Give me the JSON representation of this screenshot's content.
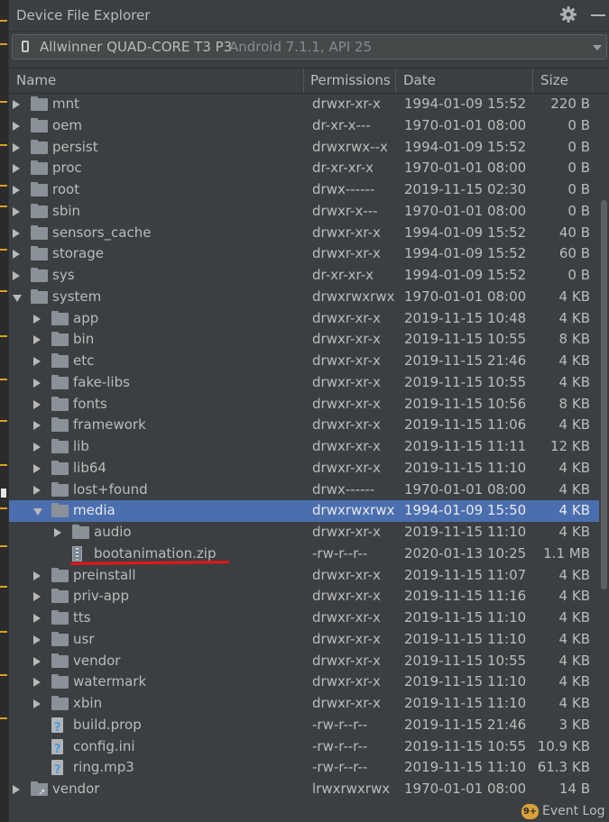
{
  "window": {
    "title": "Device File Explorer",
    "icons": [
      "gear-icon",
      "minimize-icon"
    ]
  },
  "device": {
    "name": "Allwinner QUAD-CORE T3 P3",
    "version": "Android 7.1.1, API 25"
  },
  "columns": {
    "name": "Name",
    "permissions": "Permissions",
    "date": "Date",
    "size": "Size"
  },
  "rows": [
    {
      "name": "mnt",
      "perm": "drwxr-xr-x",
      "date": "1994-01-09 15:52",
      "size": "220 B",
      "depth": 0,
      "type": "folder",
      "state": "closed"
    },
    {
      "name": "oem",
      "perm": "dr-xr-x---",
      "date": "1970-01-01 08:00",
      "size": "0 B",
      "depth": 0,
      "type": "folder",
      "state": "closed"
    },
    {
      "name": "persist",
      "perm": "drwxrwx--x",
      "date": "1994-01-09 15:52",
      "size": "0 B",
      "depth": 0,
      "type": "folder",
      "state": "closed"
    },
    {
      "name": "proc",
      "perm": "dr-xr-xr-x",
      "date": "1970-01-01 08:00",
      "size": "0 B",
      "depth": 0,
      "type": "folder",
      "state": "closed"
    },
    {
      "name": "root",
      "perm": "drwx------",
      "date": "2019-11-15 02:30",
      "size": "0 B",
      "depth": 0,
      "type": "folder",
      "state": "closed"
    },
    {
      "name": "sbin",
      "perm": "drwxr-x---",
      "date": "1970-01-01 08:00",
      "size": "0 B",
      "depth": 0,
      "type": "folder",
      "state": "closed"
    },
    {
      "name": "sensors_cache",
      "perm": "drwxr-xr-x",
      "date": "1994-01-09 15:52",
      "size": "40 B",
      "depth": 0,
      "type": "folder",
      "state": "closed"
    },
    {
      "name": "storage",
      "perm": "drwxr-xr-x",
      "date": "1994-01-09 15:52",
      "size": "60 B",
      "depth": 0,
      "type": "folder",
      "state": "closed"
    },
    {
      "name": "sys",
      "perm": "dr-xr-xr-x",
      "date": "1994-01-09 15:52",
      "size": "0 B",
      "depth": 0,
      "type": "folder",
      "state": "closed"
    },
    {
      "name": "system",
      "perm": "drwxrwxrwx",
      "date": "1970-01-01 08:00",
      "size": "4 KB",
      "depth": 0,
      "type": "folder",
      "state": "open"
    },
    {
      "name": "app",
      "perm": "drwxr-xr-x",
      "date": "2019-11-15 10:48",
      "size": "4 KB",
      "depth": 1,
      "type": "folder",
      "state": "closed"
    },
    {
      "name": "bin",
      "perm": "drwxr-xr-x",
      "date": "2019-11-15 10:55",
      "size": "8 KB",
      "depth": 1,
      "type": "folder",
      "state": "closed"
    },
    {
      "name": "etc",
      "perm": "drwxr-xr-x",
      "date": "2019-11-15 21:46",
      "size": "4 KB",
      "depth": 1,
      "type": "folder",
      "state": "closed"
    },
    {
      "name": "fake-libs",
      "perm": "drwxr-xr-x",
      "date": "2019-11-15 10:55",
      "size": "4 KB",
      "depth": 1,
      "type": "folder",
      "state": "closed"
    },
    {
      "name": "fonts",
      "perm": "drwxr-xr-x",
      "date": "2019-11-15 10:56",
      "size": "8 KB",
      "depth": 1,
      "type": "folder",
      "state": "closed"
    },
    {
      "name": "framework",
      "perm": "drwxr-xr-x",
      "date": "2019-11-15 11:06",
      "size": "4 KB",
      "depth": 1,
      "type": "folder",
      "state": "closed"
    },
    {
      "name": "lib",
      "perm": "drwxr-xr-x",
      "date": "2019-11-15 11:11",
      "size": "12 KB",
      "depth": 1,
      "type": "folder",
      "state": "closed"
    },
    {
      "name": "lib64",
      "perm": "drwxr-xr-x",
      "date": "2019-11-15 11:10",
      "size": "4 KB",
      "depth": 1,
      "type": "folder",
      "state": "closed"
    },
    {
      "name": "lost+found",
      "perm": "drwx------",
      "date": "1970-01-01 08:00",
      "size": "4 KB",
      "depth": 1,
      "type": "folder",
      "state": "closed"
    },
    {
      "name": "media",
      "perm": "drwxrwxrwx",
      "date": "1994-01-09 15:50",
      "size": "4 KB",
      "depth": 1,
      "type": "folder",
      "state": "open",
      "selected": true
    },
    {
      "name": "audio",
      "perm": "drwxr-xr-x",
      "date": "2019-11-15 11:10",
      "size": "4 KB",
      "depth": 2,
      "type": "folder",
      "state": "closed"
    },
    {
      "name": "bootanimation.zip",
      "perm": "-rw-r--r--",
      "date": "2020-01-13 10:25",
      "size": "1.1 MB",
      "depth": 2,
      "type": "zip",
      "state": "none",
      "underlined": true
    },
    {
      "name": "preinstall",
      "perm": "drwxr-xr-x",
      "date": "2019-11-15 11:07",
      "size": "4 KB",
      "depth": 1,
      "type": "folder",
      "state": "closed"
    },
    {
      "name": "priv-app",
      "perm": "drwxr-xr-x",
      "date": "2019-11-15 11:16",
      "size": "4 KB",
      "depth": 1,
      "type": "folder",
      "state": "closed"
    },
    {
      "name": "tts",
      "perm": "drwxr-xr-x",
      "date": "2019-11-15 11:10",
      "size": "4 KB",
      "depth": 1,
      "type": "folder",
      "state": "closed"
    },
    {
      "name": "usr",
      "perm": "drwxr-xr-x",
      "date": "2019-11-15 11:10",
      "size": "4 KB",
      "depth": 1,
      "type": "folder",
      "state": "closed"
    },
    {
      "name": "vendor",
      "perm": "drwxr-xr-x",
      "date": "2019-11-15 10:55",
      "size": "4 KB",
      "depth": 1,
      "type": "folder",
      "state": "closed"
    },
    {
      "name": "watermark",
      "perm": "drwxr-xr-x",
      "date": "2019-11-15 11:10",
      "size": "4 KB",
      "depth": 1,
      "type": "folder",
      "state": "closed"
    },
    {
      "name": "xbin",
      "perm": "drwxr-xr-x",
      "date": "2019-11-15 11:10",
      "size": "4 KB",
      "depth": 1,
      "type": "folder",
      "state": "closed"
    },
    {
      "name": "build.prop",
      "perm": "-rw-r--r--",
      "date": "2019-11-15 21:46",
      "size": "3 KB",
      "depth": 1,
      "type": "file",
      "state": "none"
    },
    {
      "name": "config.ini",
      "perm": "-rw-r--r--",
      "date": "2019-11-15 10:55",
      "size": "10.9 KB",
      "depth": 1,
      "type": "file",
      "state": "none"
    },
    {
      "name": "ring.mp3",
      "perm": "-rw-r--r--",
      "date": "2019-11-15 11:10",
      "size": "61.3 KB",
      "depth": 1,
      "type": "file",
      "state": "none"
    },
    {
      "name": "vendor",
      "perm": "lrwxrwxrwx",
      "date": "1970-01-01 08:00",
      "size": "14 B",
      "depth": 0,
      "type": "link",
      "state": "closed"
    }
  ],
  "status": {
    "badge": "9+",
    "event_log": "Event Log"
  },
  "colors": {
    "background": "#3c3f41",
    "selection": "#4b6eaf",
    "text": "#bbbbbb",
    "annotation_underline": "#e8141a",
    "badge": "#d9a13a"
  }
}
